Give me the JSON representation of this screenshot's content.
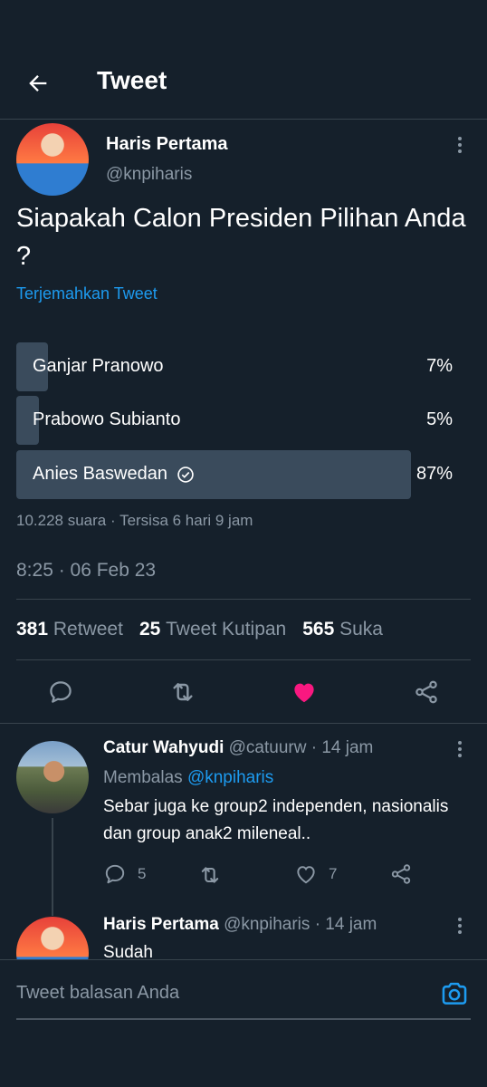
{
  "header": {
    "title": "Tweet",
    "back_icon": "arrow-left-icon"
  },
  "tweet": {
    "author_name": "Haris Pertama",
    "author_handle": "@knpiharis",
    "text": "Siapakah Calon Presiden Pilihan Anda ?",
    "translate_label": "Terjemahkan Tweet",
    "poll": {
      "options": [
        {
          "label": "Ganjar Pranowo",
          "percent_label": "7%",
          "percent": 7,
          "winner": false
        },
        {
          "label": "Prabowo Subianto",
          "percent_label": "5%",
          "percent": 5,
          "winner": false
        },
        {
          "label": "Anies Baswedan",
          "percent_label": "87%",
          "percent": 87,
          "winner": true
        }
      ],
      "votes": "10.228 suara",
      "separator": " · ",
      "remaining": "Tersisa 6 hari 9 jam"
    },
    "timestamp": "8:25 · 06 Feb 23",
    "stats": {
      "retweets_count": "381",
      "retweets_label": "Retweet",
      "quotes_count": "25",
      "quotes_label": "Tweet Kutipan",
      "likes_count": "565",
      "likes_label": "Suka"
    }
  },
  "replies": [
    {
      "author_name": "Catur Wahyudi",
      "author_handle": "@catuurw",
      "time": "· 14 jam",
      "replying_prefix": "Membalas",
      "replying_to": "@knpiharis",
      "text": "Sebar juga ke group2 independen, nasionalis dan group anak2 mileneal..",
      "reply_count": "5",
      "like_count": "7"
    },
    {
      "author_name": "Haris Pertama",
      "author_handle": "@knpiharis",
      "time": "· 14 jam",
      "text": "Sudah"
    }
  ],
  "composer": {
    "placeholder": "Tweet balasan Anda"
  },
  "colors": {
    "background": "#15202b",
    "accent": "#1d9bf0",
    "like": "#f91880",
    "poll_bar": "#3a4b5c",
    "muted": "#8b98a5"
  }
}
